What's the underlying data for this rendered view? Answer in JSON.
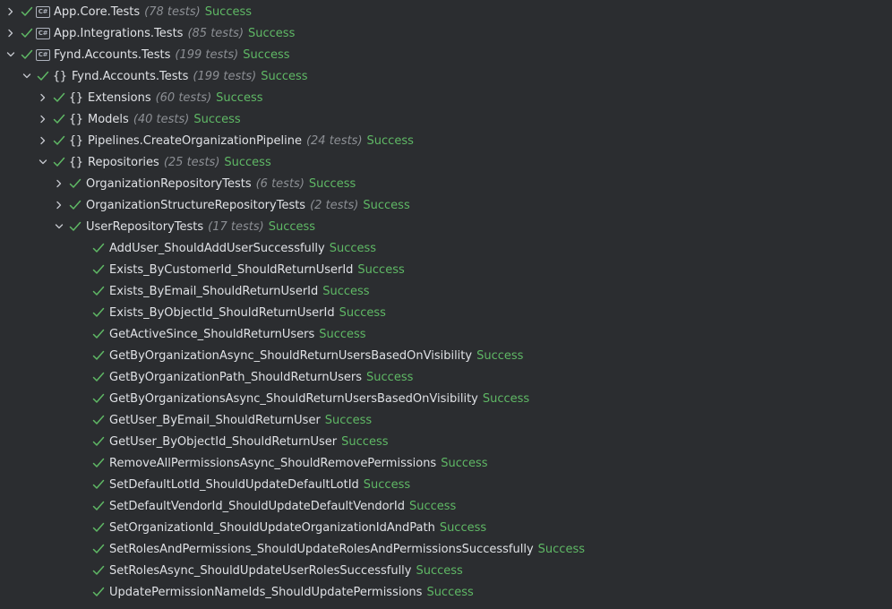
{
  "status_text": "Success",
  "colors": {
    "background": "#2b2d30",
    "success": "#5fb865",
    "count": "#8c8f94",
    "text": "#dfe1e5",
    "chevron": "#c5c8ce"
  },
  "rows": [
    {
      "name": "App.Core.Tests",
      "count": "(78 tests)",
      "status": "Success",
      "expanded": false,
      "icon": "csharp-icon",
      "level": 0
    },
    {
      "name": "App.Integrations.Tests",
      "count": "(85 tests)",
      "status": "Success",
      "expanded": false,
      "icon": "csharp-icon",
      "level": 0
    },
    {
      "name": "Fynd.Accounts.Tests",
      "count": "(199 tests)",
      "status": "Success",
      "expanded": true,
      "icon": "csharp-icon",
      "level": 0
    },
    {
      "name": "Fynd.Accounts.Tests",
      "count": "(199 tests)",
      "status": "Success",
      "expanded": true,
      "icon": "namespace-icon",
      "level": 1
    },
    {
      "name": "Extensions",
      "count": "(60 tests)",
      "status": "Success",
      "expanded": false,
      "icon": "namespace-icon",
      "level": 2
    },
    {
      "name": "Models",
      "count": "(40 tests)",
      "status": "Success",
      "expanded": false,
      "icon": "namespace-icon",
      "level": 2
    },
    {
      "name": "Pipelines.CreateOrganizationPipeline",
      "count": "(24 tests)",
      "status": "Success",
      "expanded": false,
      "icon": "namespace-icon",
      "level": 2
    },
    {
      "name": "Repositories",
      "count": "(25 tests)",
      "status": "Success",
      "expanded": true,
      "icon": "namespace-icon",
      "level": 2
    },
    {
      "name": "OrganizationRepositoryTests",
      "count": "(6 tests)",
      "status": "Success",
      "expanded": false,
      "icon": "",
      "level": 3
    },
    {
      "name": "OrganizationStructureRepositoryTests",
      "count": "(2 tests)",
      "status": "Success",
      "expanded": false,
      "icon": "",
      "level": 3
    },
    {
      "name": "UserRepositoryTests",
      "count": "(17 tests)",
      "status": "Success",
      "expanded": true,
      "icon": "",
      "level": 3
    },
    {
      "name": "AddUser_ShouldAddUserSuccessfully",
      "status": "Success",
      "level": 4
    },
    {
      "name": "Exists_ByCustomerId_ShouldReturnUserId",
      "status": "Success",
      "level": 4
    },
    {
      "name": "Exists_ByEmail_ShouldReturnUserId",
      "status": "Success",
      "level": 4
    },
    {
      "name": "Exists_ByObjectId_ShouldReturnUserId",
      "status": "Success",
      "level": 4
    },
    {
      "name": "GetActiveSince_ShouldReturnUsers",
      "status": "Success",
      "level": 4
    },
    {
      "name": "GetByOrganizationAsync_ShouldReturnUsersBasedOnVisibility",
      "status": "Success",
      "level": 4
    },
    {
      "name": "GetByOrganizationPath_ShouldReturnUsers",
      "status": "Success",
      "level": 4
    },
    {
      "name": "GetByOrganizationsAsync_ShouldReturnUsersBasedOnVisibility",
      "status": "Success",
      "level": 4
    },
    {
      "name": "GetUser_ByEmail_ShouldReturnUser",
      "status": "Success",
      "level": 4
    },
    {
      "name": "GetUser_ByObjectId_ShouldReturnUser",
      "status": "Success",
      "level": 4
    },
    {
      "name": "RemoveAllPermissionsAsync_ShouldRemovePermissions",
      "status": "Success",
      "level": 4
    },
    {
      "name": "SetDefaultLotId_ShouldUpdateDefaultLotId",
      "status": "Success",
      "level": 4
    },
    {
      "name": "SetDefaultVendorId_ShouldUpdateDefaultVendorId",
      "status": "Success",
      "level": 4
    },
    {
      "name": "SetOrganizationId_ShouldUpdateOrganizationIdAndPath",
      "status": "Success",
      "level": 4
    },
    {
      "name": "SetRolesAndPermissions_ShouldUpdateRolesAndPermissionsSuccessfully",
      "status": "Success",
      "level": 4
    },
    {
      "name": "SetRolesAsync_ShouldUpdateUserRolesSuccessfully",
      "status": "Success",
      "level": 4
    },
    {
      "name": "UpdatePermissionNameIds_ShouldUpdatePermissions",
      "status": "Success",
      "level": 4
    }
  ]
}
